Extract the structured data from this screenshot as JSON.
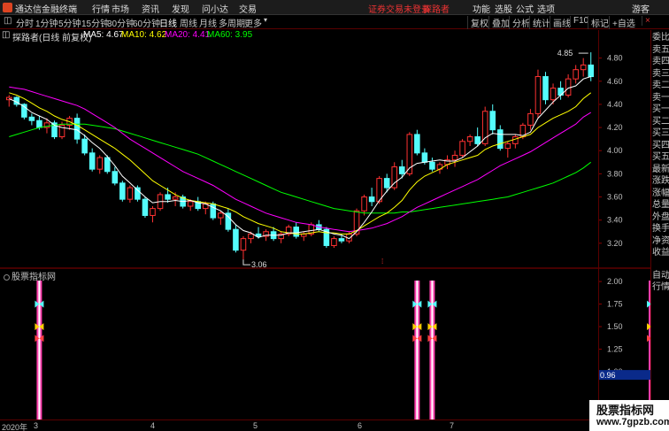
{
  "titlebar": {
    "app_name": "通达信金融终端",
    "menus": [
      "行情",
      "市场",
      "资讯",
      "发现",
      "问小达",
      "交易"
    ],
    "notice": "证券交易未登录",
    "notice2": "探路者",
    "right_items": [
      "功能",
      "选股",
      "公式",
      "选项",
      "游客"
    ]
  },
  "toolbar": {
    "periods": [
      "分时",
      "1分钟",
      "5分钟",
      "15分钟",
      "30分钟",
      "60分钟",
      "日线",
      "周线",
      "月线",
      "多周期",
      "更多"
    ],
    "active_period": "日线",
    "right_buttons": [
      "复权",
      "叠加",
      "分析",
      "统计",
      "画线",
      "F10",
      "标记",
      "+自选"
    ]
  },
  "legend": {
    "title": "探路者(日线 前复权)",
    "ma5": "MA5: 4.67",
    "ma10": "MA10: 4.62",
    "ma20": "MA20: 4.41",
    "ma60": "MA60: 3.95",
    "colors": {
      "ma5": "#ffffff",
      "ma10": "#ffff00",
      "ma20": "#ff00ff",
      "ma60": "#00ff00"
    }
  },
  "price_axis": {
    "ticks": [
      "4.80",
      "4.60",
      "4.40",
      "4.20",
      "4.00",
      "3.80",
      "3.60",
      "3.40",
      "3.20"
    ],
    "high_label": "4.85",
    "low_label": "3.06"
  },
  "indicator": {
    "title": "股票指标网",
    "ticks": [
      "2.00",
      "1.75",
      "1.50",
      "1.25",
      "1.00"
    ],
    "current_value": "0.96"
  },
  "right_panel": {
    "items": [
      "委比",
      "卖五",
      "卖四",
      "卖三",
      "卖二",
      "卖一",
      "买一",
      "买二",
      "买三",
      "买四",
      "买五",
      "最新",
      "涨跌",
      "涨幅",
      "总量",
      "外盘",
      "换手",
      "净资",
      "收益",
      "自动",
      "行情"
    ]
  },
  "x_axis": {
    "labels": [
      "2020年",
      "3",
      "4",
      "5",
      "6",
      "7"
    ]
  },
  "watermark": {
    "line1": "股票指标网",
    "line2": "www.7gpzb.com"
  },
  "chart_data": {
    "type": "candlestick",
    "title": "探路者(日线 前复权)",
    "ylim": [
      3.0,
      4.95
    ],
    "candles": [
      [
        4.44,
        4.48,
        4.38,
        4.46
      ],
      [
        4.46,
        4.47,
        4.38,
        4.4
      ],
      [
        4.4,
        4.41,
        4.27,
        4.29
      ],
      [
        4.29,
        4.32,
        4.22,
        4.26
      ],
      [
        4.26,
        4.3,
        4.18,
        4.2
      ],
      [
        4.2,
        4.28,
        4.15,
        4.24
      ],
      [
        4.24,
        4.26,
        4.1,
        4.12
      ],
      [
        4.12,
        4.25,
        4.1,
        4.22
      ],
      [
        4.22,
        4.3,
        4.18,
        4.28
      ],
      [
        4.28,
        4.32,
        4.06,
        4.1
      ],
      [
        4.1,
        4.14,
        3.96,
        3.98
      ],
      [
        3.98,
        4.02,
        3.82,
        3.84
      ],
      [
        3.84,
        3.96,
        3.8,
        3.94
      ],
      [
        3.94,
        3.96,
        3.8,
        3.82
      ],
      [
        3.82,
        3.86,
        3.7,
        3.72
      ],
      [
        3.72,
        3.74,
        3.56,
        3.58
      ],
      [
        3.58,
        3.7,
        3.55,
        3.68
      ],
      [
        3.68,
        3.7,
        3.56,
        3.58
      ],
      [
        3.58,
        3.6,
        3.42,
        3.44
      ],
      [
        3.44,
        3.52,
        3.38,
        3.5
      ],
      [
        3.5,
        3.64,
        3.48,
        3.62
      ],
      [
        3.62,
        3.68,
        3.55,
        3.58
      ],
      [
        3.58,
        3.64,
        3.52,
        3.6
      ],
      [
        3.6,
        3.62,
        3.5,
        3.52
      ],
      [
        3.52,
        3.58,
        3.48,
        3.56
      ],
      [
        3.56,
        3.6,
        3.48,
        3.5
      ],
      [
        3.5,
        3.56,
        3.45,
        3.54
      ],
      [
        3.54,
        3.56,
        3.4,
        3.42
      ],
      [
        3.42,
        3.48,
        3.36,
        3.46
      ],
      [
        3.46,
        3.5,
        3.3,
        3.32
      ],
      [
        3.32,
        3.36,
        3.12,
        3.14
      ],
      [
        3.14,
        3.26,
        3.06,
        3.24
      ],
      [
        3.24,
        3.3,
        3.2,
        3.28
      ],
      [
        3.28,
        3.34,
        3.24,
        3.26
      ],
      [
        3.26,
        3.32,
        3.22,
        3.3
      ],
      [
        3.3,
        3.34,
        3.22,
        3.24
      ],
      [
        3.24,
        3.3,
        3.2,
        3.28
      ],
      [
        3.28,
        3.36,
        3.26,
        3.34
      ],
      [
        3.34,
        3.38,
        3.24,
        3.26
      ],
      [
        3.26,
        3.3,
        3.22,
        3.28
      ],
      [
        3.28,
        3.38,
        3.26,
        3.36
      ],
      [
        3.36,
        3.4,
        3.3,
        3.32
      ],
      [
        3.32,
        3.34,
        3.16,
        3.18
      ],
      [
        3.18,
        3.26,
        3.16,
        3.24
      ],
      [
        3.24,
        3.28,
        3.2,
        3.22
      ],
      [
        3.22,
        3.3,
        3.2,
        3.28
      ],
      [
        3.28,
        3.5,
        3.26,
        3.48
      ],
      [
        3.48,
        3.62,
        3.44,
        3.6
      ],
      [
        3.6,
        3.68,
        3.52,
        3.56
      ],
      [
        3.56,
        3.78,
        3.54,
        3.76
      ],
      [
        3.76,
        3.8,
        3.64,
        3.68
      ],
      [
        3.68,
        3.9,
        3.66,
        3.86
      ],
      [
        3.86,
        3.92,
        3.76,
        3.8
      ],
      [
        3.8,
        4.16,
        3.78,
        4.14
      ],
      [
        4.14,
        4.18,
        3.96,
        3.98
      ],
      [
        3.98,
        4.02,
        3.88,
        3.9
      ],
      [
        3.9,
        3.94,
        3.82,
        3.84
      ],
      [
        3.84,
        3.9,
        3.8,
        3.88
      ],
      [
        3.88,
        3.96,
        3.84,
        3.92
      ],
      [
        3.92,
        4.0,
        3.86,
        3.96
      ],
      [
        3.96,
        4.1,
        3.94,
        4.08
      ],
      [
        4.08,
        4.14,
        4.04,
        4.12
      ],
      [
        4.12,
        4.2,
        4.04,
        4.06
      ],
      [
        4.06,
        4.38,
        4.04,
        4.34
      ],
      [
        4.34,
        4.4,
        4.14,
        4.18
      ],
      [
        4.18,
        4.22,
        4.0,
        4.02
      ],
      [
        4.02,
        4.08,
        3.94,
        4.06
      ],
      [
        4.06,
        4.14,
        4.02,
        4.12
      ],
      [
        4.12,
        4.24,
        4.1,
        4.22
      ],
      [
        4.22,
        4.36,
        4.18,
        4.32
      ],
      [
        4.32,
        4.7,
        4.28,
        4.64
      ],
      [
        4.64,
        4.68,
        4.4,
        4.44
      ],
      [
        4.44,
        4.58,
        4.4,
        4.54
      ],
      [
        4.54,
        4.6,
        4.44,
        4.48
      ],
      [
        4.48,
        4.66,
        4.46,
        4.62
      ],
      [
        4.62,
        4.74,
        4.58,
        4.7
      ],
      [
        4.7,
        4.8,
        4.64,
        4.74
      ],
      [
        4.74,
        4.85,
        4.6,
        4.64
      ]
    ],
    "ma5": [
      4.45,
      4.42,
      4.38,
      4.33,
      4.3,
      4.27,
      4.22,
      4.2,
      4.19,
      4.18,
      4.13,
      4.07,
      4.02,
      3.95,
      3.87,
      3.78,
      3.72,
      3.66,
      3.6,
      3.55,
      3.56,
      3.56,
      3.57,
      3.56,
      3.57,
      3.55,
      3.54,
      3.51,
      3.48,
      3.43,
      3.36,
      3.31,
      3.29,
      3.25,
      3.27,
      3.27,
      3.27,
      3.29,
      3.29,
      3.3,
      3.31,
      3.32,
      3.3,
      3.28,
      3.27,
      3.24,
      3.3,
      3.38,
      3.47,
      3.57,
      3.65,
      3.72,
      3.77,
      3.85,
      3.89,
      3.9,
      3.91,
      3.92,
      3.91,
      3.91,
      3.94,
      3.99,
      4.04,
      4.11,
      4.15,
      4.14,
      4.14,
      4.14,
      4.13,
      4.16,
      4.28,
      4.35,
      4.42,
      4.48,
      4.54,
      4.56,
      4.62,
      4.64
    ],
    "ma10": [
      4.5,
      4.48,
      4.45,
      4.41,
      4.37,
      4.34,
      4.3,
      4.27,
      4.25,
      4.22,
      4.18,
      4.14,
      4.1,
      4.06,
      4.02,
      3.97,
      3.92,
      3.86,
      3.8,
      3.74,
      3.7,
      3.66,
      3.62,
      3.59,
      3.57,
      3.56,
      3.55,
      3.54,
      3.52,
      3.5,
      3.47,
      3.43,
      3.4,
      3.37,
      3.35,
      3.33,
      3.3,
      3.29,
      3.28,
      3.28,
      3.29,
      3.3,
      3.29,
      3.29,
      3.28,
      3.28,
      3.31,
      3.35,
      3.39,
      3.43,
      3.46,
      3.51,
      3.57,
      3.66,
      3.73,
      3.78,
      3.81,
      3.84,
      3.88,
      3.9,
      3.92,
      3.94,
      3.96,
      4.01,
      4.04,
      4.06,
      4.08,
      4.1,
      4.12,
      4.14,
      4.2,
      4.24,
      4.28,
      4.31,
      4.34,
      4.38,
      4.45,
      4.5
    ],
    "ma20": [
      4.55,
      4.54,
      4.53,
      4.51,
      4.49,
      4.47,
      4.45,
      4.43,
      4.41,
      4.39,
      4.36,
      4.32,
      4.28,
      4.24,
      4.2,
      4.15,
      4.1,
      4.06,
      4.02,
      3.98,
      3.94,
      3.9,
      3.86,
      3.82,
      3.79,
      3.76,
      3.73,
      3.7,
      3.66,
      3.62,
      3.58,
      3.55,
      3.52,
      3.49,
      3.46,
      3.44,
      3.42,
      3.4,
      3.38,
      3.37,
      3.36,
      3.34,
      3.33,
      3.32,
      3.31,
      3.3,
      3.31,
      3.32,
      3.33,
      3.35,
      3.37,
      3.4,
      3.43,
      3.47,
      3.51,
      3.54,
      3.57,
      3.6,
      3.63,
      3.66,
      3.69,
      3.72,
      3.75,
      3.79,
      3.83,
      3.87,
      3.9,
      3.93,
      3.96,
      3.99,
      4.03,
      4.07,
      4.11,
      4.15,
      4.19,
      4.23,
      4.29,
      4.33
    ],
    "ma60": [
      4.12,
      4.14,
      4.16,
      4.18,
      4.2,
      4.21,
      4.22,
      4.23,
      4.23,
      4.23,
      4.23,
      4.22,
      4.21,
      4.2,
      4.19,
      4.17,
      4.15,
      4.13,
      4.11,
      4.09,
      4.07,
      4.05,
      4.03,
      4.01,
      3.99,
      3.97,
      3.94,
      3.91,
      3.88,
      3.85,
      3.82,
      3.79,
      3.76,
      3.73,
      3.7,
      3.67,
      3.64,
      3.62,
      3.6,
      3.58,
      3.56,
      3.54,
      3.52,
      3.5,
      3.49,
      3.48,
      3.47,
      3.46,
      3.46,
      3.46,
      3.46,
      3.46,
      3.47,
      3.47,
      3.48,
      3.49,
      3.5,
      3.51,
      3.52,
      3.53,
      3.54,
      3.55,
      3.56,
      3.57,
      3.58,
      3.59,
      3.6,
      3.62,
      3.64,
      3.66,
      3.68,
      3.7,
      3.72,
      3.75,
      3.78,
      3.81,
      3.85,
      3.9
    ],
    "signals": [
      4,
      54,
      56,
      85
    ]
  }
}
